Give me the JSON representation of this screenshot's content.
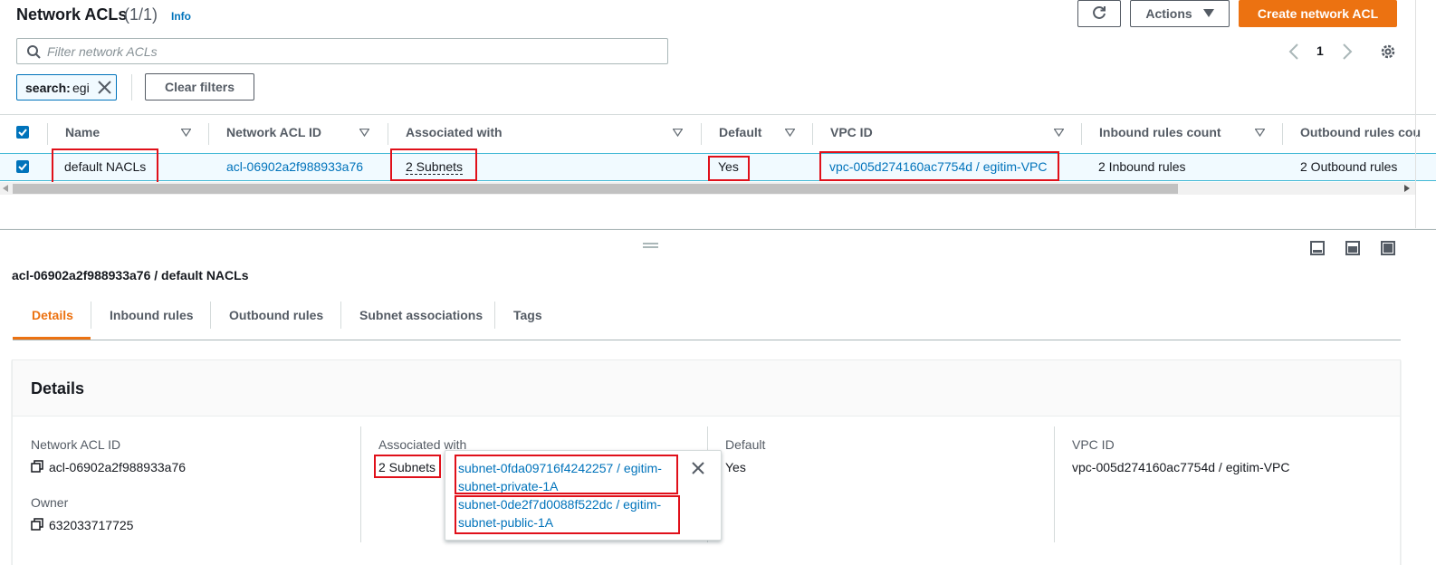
{
  "header": {
    "title": "Network ACLs",
    "count": "(1/1)",
    "info": "Info",
    "actions_label": "Actions",
    "create_label": "Create network ACL"
  },
  "filter": {
    "placeholder": "Filter network ACLs",
    "token_label": "search:",
    "token_value": "egi",
    "clear_label": "Clear filters"
  },
  "pagination": {
    "page": "1"
  },
  "table": {
    "columns": [
      "Name",
      "Network ACL ID",
      "Associated with",
      "Default",
      "VPC ID",
      "Inbound rules count",
      "Outbound rules cou"
    ],
    "row": {
      "name": "default NACLs",
      "acl_id": "acl-06902a2f988933a76",
      "associated": "2 Subnets",
      "default": "Yes",
      "vpc_id": "vpc-005d274160ac7754d / egitim-VPC",
      "inbound": "2 Inbound rules",
      "outbound": "2 Outbound rules"
    }
  },
  "details": {
    "heading": "acl-06902a2f988933a76 / default NACLs",
    "tabs": [
      "Details",
      "Inbound rules",
      "Outbound rules",
      "Subnet associations",
      "Tags"
    ],
    "card_title": "Details",
    "fields": {
      "acl_id_label": "Network ACL ID",
      "acl_id_value": "acl-06902a2f988933a76",
      "owner_label": "Owner",
      "owner_value": "632033717725",
      "assoc_label": "Associated with",
      "assoc_value": "2 Subnets",
      "default_label": "Default",
      "default_value": "Yes",
      "vpc_label": "VPC ID",
      "vpc_value": "vpc-005d274160ac7754d / egitim-VPC"
    },
    "popover": {
      "subnet1_line1": "subnet-0fda09716f4242257 / egitim-",
      "subnet1_line2": "subnet-private-1A",
      "subnet2_line1": "subnet-0de2f7d0088f522dc / egitim-",
      "subnet2_line2": "subnet-public-1A"
    }
  },
  "colors": {
    "accent": "#ec7211",
    "link": "#0073bb",
    "highlight": "#e0101a"
  }
}
